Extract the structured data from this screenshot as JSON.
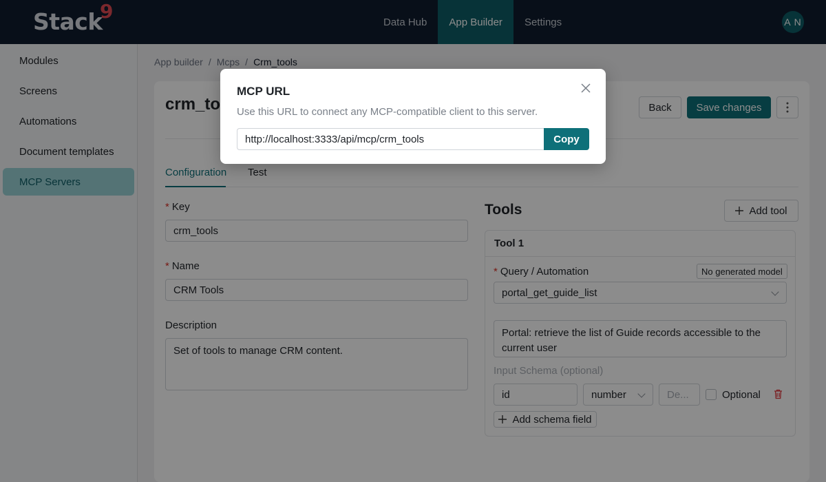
{
  "app": {
    "logo_text": "Stack",
    "logo_mark": "9"
  },
  "nav": {
    "items": [
      {
        "label": "Data Hub",
        "active": false
      },
      {
        "label": "App Builder",
        "active": true
      },
      {
        "label": "Settings",
        "active": false
      }
    ]
  },
  "user": {
    "initials": "A N"
  },
  "sidebar": {
    "items": [
      {
        "label": "Modules",
        "active": false
      },
      {
        "label": "Screens",
        "active": false
      },
      {
        "label": "Automations",
        "active": false
      },
      {
        "label": "Document templates",
        "active": false
      },
      {
        "label": "MCP Servers",
        "active": true
      }
    ]
  },
  "breadcrumb": {
    "items": [
      "App builder",
      "Mcps",
      "Crm_tools"
    ],
    "separator": "/"
  },
  "page": {
    "title": "crm_tools",
    "back_label": "Back",
    "save_label": "Save changes",
    "more_icon": "more-vertical-icon"
  },
  "tabs": [
    {
      "label": "Configuration",
      "active": true
    },
    {
      "label": "Test",
      "active": false
    }
  ],
  "form": {
    "required_mark": "*",
    "key_label": "Key",
    "key_value": "crm_tools",
    "name_label": "Name",
    "name_value": "CRM Tools",
    "description_label": "Description",
    "description_value": "Set of tools to manage CRM content."
  },
  "tools": {
    "title": "Tools",
    "add_label": "Add tool",
    "items": [
      {
        "title": "Tool 1",
        "query_label": "Query / Automation",
        "model_tag": "No generated model",
        "query_value": "portal_get_guide_list",
        "description": "Portal: retrieve the list of Guide records accessible to the current user",
        "schema_label": "Input Schema (optional)",
        "schema_fields": [
          {
            "name": "id",
            "type": "number",
            "desc_placeholder": "De...",
            "optional_label": "Optional",
            "optional": false
          }
        ],
        "add_schema_label": "Add schema field"
      }
    ]
  },
  "modal": {
    "title": "MCP URL",
    "description": "Use this URL to connect any MCP-compatible client to this server.",
    "url": "http://localhost:3333/api/mcp/crm_tools",
    "copy_label": "Copy"
  },
  "colors": {
    "topbar": "#0f1c2e",
    "accent": "#0e7079",
    "sidebar_active": "#9ad1d6",
    "logo_mark": "#e04a52"
  }
}
